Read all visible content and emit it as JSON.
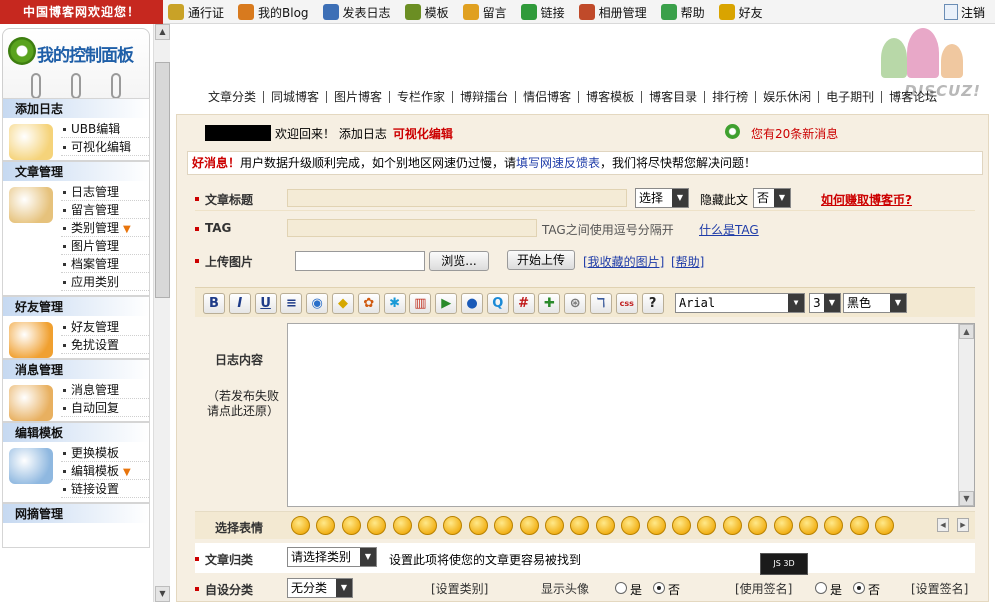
{
  "topbar": {
    "welcome": "中国博客网欢迎您！",
    "nav": [
      {
        "label": "通行证",
        "icon": "passport-icon",
        "color": "#c9a227"
      },
      {
        "label": "我的Blog",
        "icon": "home-icon",
        "color": "#d87a1e"
      },
      {
        "label": "发表日志",
        "icon": "pen-icon",
        "color": "#3d6fb6"
      },
      {
        "label": "模板",
        "icon": "template-icon",
        "color": "#6b8e23"
      },
      {
        "label": "留言",
        "icon": "message-icon",
        "color": "#e0a020"
      },
      {
        "label": "链接",
        "icon": "link-icon",
        "color": "#2f9a3a"
      },
      {
        "label": "相册管理",
        "icon": "album-icon",
        "color": "#c04a2a"
      },
      {
        "label": "帮助",
        "icon": "help-icon",
        "color": "#3aa04a"
      },
      {
        "label": "好友",
        "icon": "friends-icon",
        "color": "#d9a400"
      }
    ],
    "logout": "注销"
  },
  "sidebar": {
    "panel_title": "我的控制面板",
    "sections": [
      {
        "title": "添加日志",
        "art_color": "#f5d37a",
        "items": [
          {
            "label": "UBB编辑"
          },
          {
            "label": "可视化编辑"
          }
        ]
      },
      {
        "title": "文章管理",
        "art_color": "#e6c27c",
        "items": [
          {
            "label": "日志管理"
          },
          {
            "label": "留言管理"
          },
          {
            "label": "类别管理",
            "caret": "▼"
          },
          {
            "label": "图片管理"
          },
          {
            "label": "档案管理"
          },
          {
            "label": "应用类别"
          }
        ]
      },
      {
        "title": "好友管理",
        "art_color": "#f0a030",
        "items": [
          {
            "label": "好友管理"
          },
          {
            "label": "免扰设置"
          }
        ]
      },
      {
        "title": "消息管理",
        "art_color": "#e8b060",
        "items": [
          {
            "label": "消息管理"
          },
          {
            "label": "自动回复"
          }
        ]
      },
      {
        "title": "编辑模板",
        "art_color": "#8fb8e0",
        "items": [
          {
            "label": "更换模板"
          },
          {
            "label": "编辑模板",
            "caret": "▼"
          },
          {
            "label": "链接设置"
          }
        ]
      },
      {
        "title": "网摘管理",
        "art_color": "#cccccc",
        "items": []
      }
    ]
  },
  "catnav": [
    "文章分类",
    "同城博客",
    "图片博客",
    "专栏作家",
    "博辩擂台",
    "情侣博客",
    "博客模板",
    "博客目录",
    "排行榜",
    "娱乐休闲",
    "电子期刊",
    "博客论坛"
  ],
  "brand": {
    "discuz": "DISCUZ!"
  },
  "greeting": {
    "text": "欢迎回来！  添加日志",
    "mode": "可视化编辑",
    "messages": "您有20条新消息"
  },
  "notice": {
    "hot": "好消息！",
    "text1": "用户数据升级顺利完成，如个别地区网速仍过慢，请",
    "link": "填写网速反馈表",
    "text2": "，我们将尽快帮您解决问题！"
  },
  "form": {
    "title_label": "文章标题",
    "select_label": "选择",
    "hide_label": "隐藏此文",
    "hide_value": "否",
    "earn_link": "如何赚取博客币?",
    "tag_label": "TAG",
    "tag_hint": "TAG之间使用逗号分隔开",
    "tag_help": "什么是TAG",
    "upload_label": "上传图片",
    "browse_btn": "浏览...",
    "upload_btn": "开始上传",
    "fav_link": "[我收藏的图片]",
    "help_link": "[帮助]",
    "content_label": "日志内容",
    "restore_hint": "（若发布失败请点此还原）",
    "font_name": "Arial",
    "font_size": "3",
    "font_color": "黑色",
    "emoji_label": "选择表情",
    "category_label": "文章归类",
    "category_value": "请选择类别",
    "category_hint": "设置此项将使您的文章更容易被找到",
    "custom_label": "自设分类",
    "custom_value": "无分类",
    "set_category": "[设置类别]",
    "show_avatar": "显示头像",
    "yes": "是",
    "no": "否",
    "use_sig": "[使用签名]",
    "set_sig": "[设置签名]"
  },
  "toolbar": [
    {
      "name": "bold-button",
      "glyph": "B",
      "color": "#1f3c88"
    },
    {
      "name": "italic-button",
      "glyph": "I",
      "color": "#1f3c88"
    },
    {
      "name": "underline-button",
      "glyph": "U",
      "color": "#1f3c88"
    },
    {
      "name": "align-button",
      "glyph": "≡",
      "color": "#1f3c88"
    },
    {
      "name": "insert-link-button",
      "glyph": "◉",
      "color": "#2a6fc9"
    },
    {
      "name": "insert-note-button",
      "glyph": "◆",
      "color": "#d6a800"
    },
    {
      "name": "palette-button",
      "glyph": "✿",
      "color": "#d05a10"
    },
    {
      "name": "special-char-button",
      "glyph": "✱",
      "color": "#1a9ad6"
    },
    {
      "name": "media-button",
      "glyph": "▥",
      "color": "#c03020"
    },
    {
      "name": "play-button",
      "glyph": "▶",
      "color": "#2a8a2a"
    },
    {
      "name": "chat-button",
      "glyph": "●",
      "color": "#1a5ab8"
    },
    {
      "name": "search-button",
      "glyph": "Q",
      "color": "#1a8ad6"
    },
    {
      "name": "hash-button",
      "glyph": "#",
      "color": "#c01818"
    },
    {
      "name": "comment-button",
      "glyph": "✚",
      "color": "#2a8a2a"
    },
    {
      "name": "wrap-button",
      "glyph": "⊛",
      "color": "#777777"
    },
    {
      "name": "cut-button",
      "glyph": "ℸ",
      "color": "#3a5a9a"
    },
    {
      "name": "css-button",
      "glyph": "css",
      "color": "#c02020"
    },
    {
      "name": "help-cursor-button",
      "glyph": "?",
      "color": "#222222"
    }
  ],
  "emojis": {
    "count": 24
  },
  "mini_widget": {
    "label": "JS 3D"
  }
}
